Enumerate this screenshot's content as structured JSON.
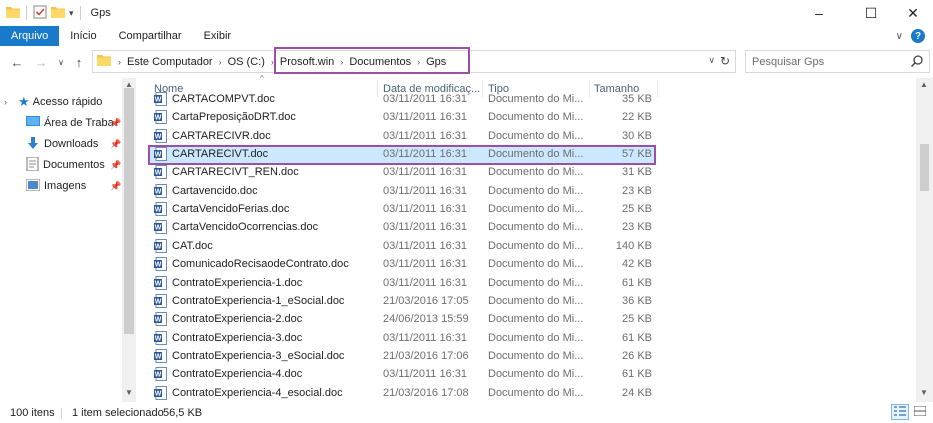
{
  "window": {
    "title": "Gps",
    "min_glyph": "–",
    "max_glyph": "☐",
    "close_glyph": "✕"
  },
  "ribbon": {
    "tabs": [
      "Arquivo",
      "Início",
      "Compartilhar",
      "Exibir"
    ],
    "expand_glyph": "∨",
    "help_glyph": "?",
    "active_color": "#1979ca"
  },
  "address": {
    "crumbs": [
      "Este Computador",
      "OS (C:)",
      "Prosoft.win",
      "Documentos",
      "Gps"
    ],
    "highlight_color": "#9b4fa6"
  },
  "search": {
    "placeholder": "Pesquisar Gps"
  },
  "nav": {
    "items": [
      {
        "label": "Acesso rápido",
        "icon": "star-icon"
      },
      {
        "label": "Área de Traba",
        "icon": "desktop-icon"
      },
      {
        "label": "Downloads",
        "icon": "download-arrow-icon"
      },
      {
        "label": "Documentos",
        "icon": "documents-icon"
      },
      {
        "label": "Imagens",
        "icon": "images-icon"
      }
    ]
  },
  "columns": {
    "name": "Nome",
    "date": "Data de modificaç...",
    "type": "Tipo",
    "size": "Tamanho"
  },
  "files": [
    {
      "name": "CARTACOMPVT.doc",
      "date": "03/11/2011 16:31",
      "type": "Documento do Mi...",
      "size": "35 KB"
    },
    {
      "name": "CartaPreposiçãoDRT.doc",
      "date": "03/11/2011 16:31",
      "type": "Documento do Mi...",
      "size": "22 KB"
    },
    {
      "name": "CARTARECIVR.doc",
      "date": "03/11/2011 16:31",
      "type": "Documento do Mi...",
      "size": "30 KB"
    },
    {
      "name": "CARTARECIVT.doc",
      "date": "03/11/2011 16:31",
      "type": "Documento do Mi...",
      "size": "57 KB",
      "selected": true
    },
    {
      "name": "CARTARECIVT_REN.doc",
      "date": "03/11/2011 16:31",
      "type": "Documento do Mi...",
      "size": "31 KB"
    },
    {
      "name": "Cartavencido.doc",
      "date": "03/11/2011 16:31",
      "type": "Documento do Mi...",
      "size": "23 KB"
    },
    {
      "name": "CartaVencidoFerias.doc",
      "date": "03/11/2011 16:31",
      "type": "Documento do Mi...",
      "size": "25 KB"
    },
    {
      "name": "CartaVencidoOcorrencias.doc",
      "date": "03/11/2011 16:31",
      "type": "Documento do Mi...",
      "size": "23 KB"
    },
    {
      "name": "CAT.doc",
      "date": "03/11/2011 16:31",
      "type": "Documento do Mi...",
      "size": "140 KB"
    },
    {
      "name": "ComunicadoRecisaodeContrato.doc",
      "date": "03/11/2011 16:31",
      "type": "Documento do Mi...",
      "size": "42 KB"
    },
    {
      "name": "ContratoExperiencia-1.doc",
      "date": "03/11/2011 16:31",
      "type": "Documento do Mi...",
      "size": "61 KB"
    },
    {
      "name": "ContratoExperiencia-1_eSocial.doc",
      "date": "21/03/2016 17:05",
      "type": "Documento do Mi...",
      "size": "36 KB"
    },
    {
      "name": "ContratoExperiencia-2.doc",
      "date": "24/06/2013 15:59",
      "type": "Documento do Mi...",
      "size": "25 KB"
    },
    {
      "name": "ContratoExperiencia-3.doc",
      "date": "03/11/2011 16:31",
      "type": "Documento do Mi...",
      "size": "61 KB"
    },
    {
      "name": "ContratoExperiencia-3_eSocial.doc",
      "date": "21/03/2016 17:06",
      "type": "Documento do Mi...",
      "size": "26 KB"
    },
    {
      "name": "ContratoExperiencia-4.doc",
      "date": "03/11/2011 16:31",
      "type": "Documento do Mi...",
      "size": "61 KB"
    },
    {
      "name": "ContratoExperiencia-4_esocial.doc",
      "date": "21/03/2016 17:08",
      "type": "Documento do Mi...",
      "size": "24 KB"
    }
  ],
  "status": {
    "count": "100 itens",
    "selection": "1 item selecionado",
    "selsize": "56,5 KB"
  }
}
